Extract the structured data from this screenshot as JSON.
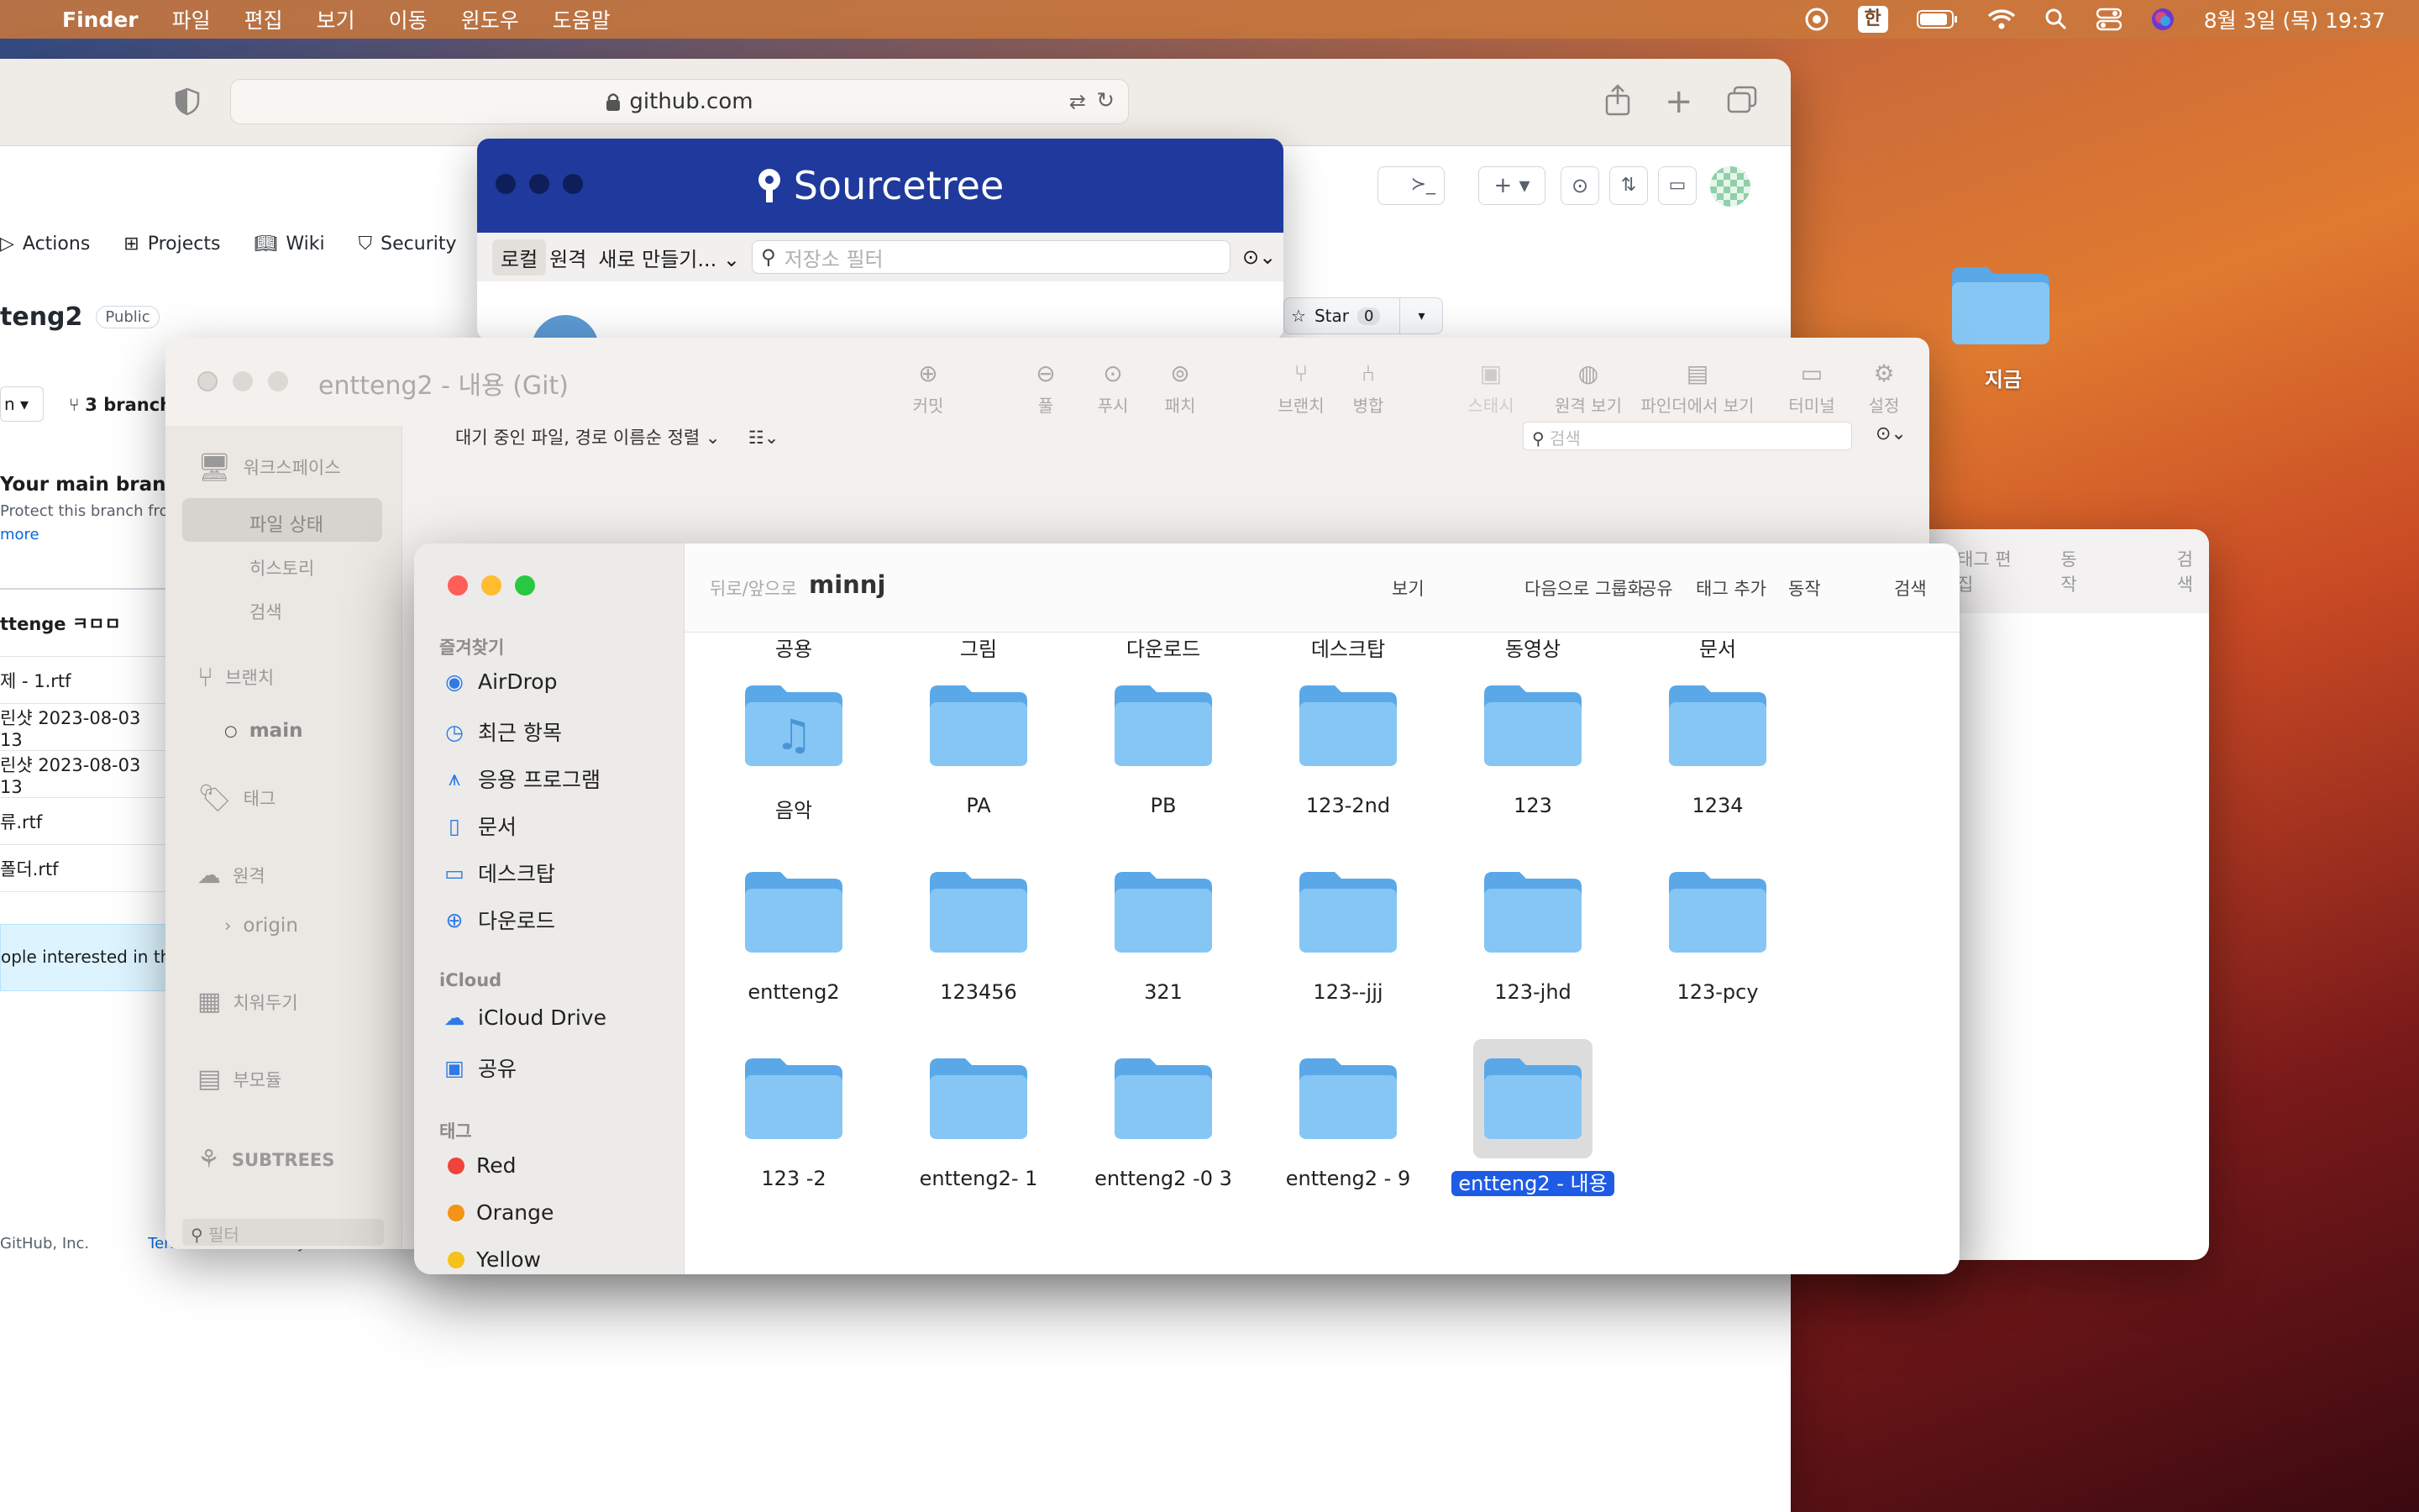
{
  "menubar": {
    "app": "Finder",
    "items": [
      "파일",
      "편집",
      "보기",
      "이동",
      "윈도우",
      "도움말"
    ],
    "input_method": "한",
    "datetime": "8월 3일 (목) 19:37"
  },
  "desktop": {
    "folder_label": "지금"
  },
  "right_window": {
    "items": [
      "태그 편집",
      "동작",
      "검색"
    ]
  },
  "safari": {
    "url": "github.com",
    "tabs": [
      "Actions",
      "Projects",
      "Wiki",
      "Security"
    ],
    "repo_name": "teng2",
    "visibility": "Public",
    "branch_menu": "n",
    "branches": "3 branch",
    "protect_title": "Your main branch",
    "protect_text": "Protect this branch from",
    "protect_link": "more",
    "star_label": "Star",
    "star_count": "0",
    "commit_title": "ttenge ㅋㅁㅁ",
    "files": [
      "제 - 1.rtf",
      "린샷 2023-08-03 13",
      "린샷 2023-08-03 13",
      "류.rtf",
      "폴더.rtf"
    ],
    "banner": "ople interested in th",
    "footer": [
      "GitHub, Inc.",
      "Terms",
      "Privacy"
    ]
  },
  "sourcetree": {
    "title": "Sourcetree",
    "tab_local": "로컬",
    "tab_remote": "원격",
    "new_menu": "새로 만들기...",
    "filter_placeholder": "저장소 필터"
  },
  "git": {
    "title": "entteng2 - 내용 (Git)",
    "toolbar": [
      "커밋",
      "풀",
      "푸시",
      "패치",
      "브랜치",
      "병합",
      "스태시",
      "원격 보기",
      "파인더에서 보기",
      "터미널",
      "설정"
    ],
    "sort_label": "대기 중인 파일, 경로 이름순 정렬",
    "search_placeholder": "검색",
    "side": {
      "workspace": "워크스페이스",
      "file_status": "파일 상태",
      "history": "히스토리",
      "search": "검색",
      "branches": "브랜치",
      "main": "main",
      "tags": "태그",
      "remotes": "원격",
      "origin": "origin",
      "stashes": "치워두기",
      "submodules": "부모듈",
      "subtrees": "SUBTREES",
      "filter": "필터"
    }
  },
  "finder": {
    "back_label": "뒤로/앞으로",
    "path": "minnj",
    "toolbar": [
      "보기",
      "다음으로 그룹화",
      "공유",
      "태그 추가",
      "동작",
      "검색"
    ],
    "favorites_header": "즐겨찾기",
    "favorites": [
      "AirDrop",
      "최근 항목",
      "응용 프로그램",
      "문서",
      "데스크탑",
      "다운로드"
    ],
    "icloud_header": "iCloud",
    "icloud": [
      "iCloud Drive",
      "공유"
    ],
    "tags_header": "태그",
    "tags": [
      {
        "name": "Red",
        "color": "#f0433a"
      },
      {
        "name": "Orange",
        "color": "#f39317"
      },
      {
        "name": "Yellow",
        "color": "#f4c21b"
      }
    ],
    "top_row": [
      "공용",
      "그림",
      "다운로드",
      "데스크탑",
      "동영상",
      "문서"
    ],
    "rows": [
      [
        "음악",
        "PA",
        "PB",
        "123-2nd",
        "123",
        "1234"
      ],
      [
        "entteng2",
        "123456",
        "321",
        "123--jjj",
        "123-jhd",
        "123-pcy"
      ],
      [
        "123 -2",
        "entteng2- 1",
        "entteng2 -0 3",
        "entteng2 - 9",
        "entteng2 - 내용"
      ]
    ],
    "selected": "entteng2 - 내용"
  }
}
